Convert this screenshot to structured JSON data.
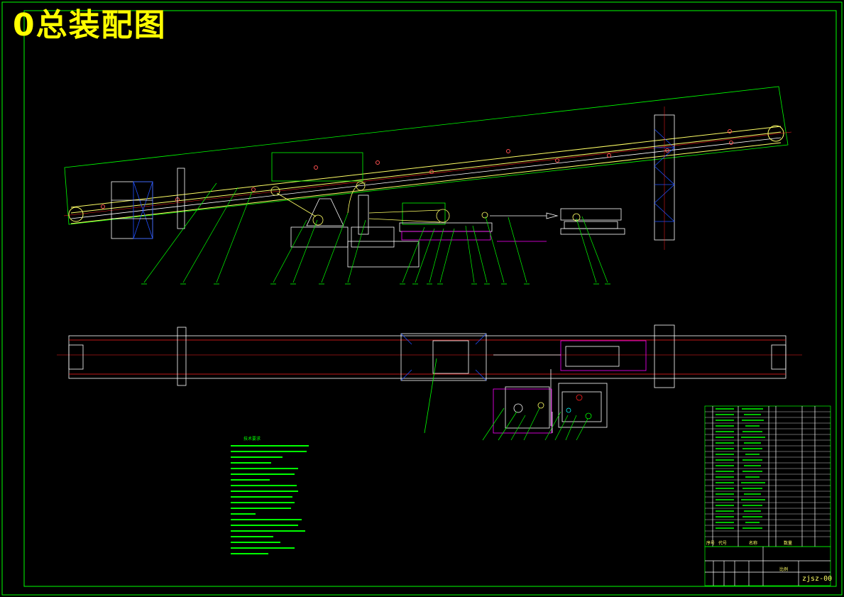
{
  "title": "0总装配图",
  "drawing_number": "zjsz-00",
  "notes_heading": "技术要求",
  "title_block": {
    "headers": [
      "序号",
      "代号",
      "名称",
      "数量"
    ],
    "scale_label": "比例"
  },
  "colors": {
    "background": "#000000",
    "frame": "#00ff00",
    "title": "#ffff00",
    "belt": "#ffff66",
    "magenta": "#ff00ff",
    "red": "#ff2020",
    "blue": "#2050ff",
    "white": "#ffffff",
    "cyan": "#00ffff"
  }
}
